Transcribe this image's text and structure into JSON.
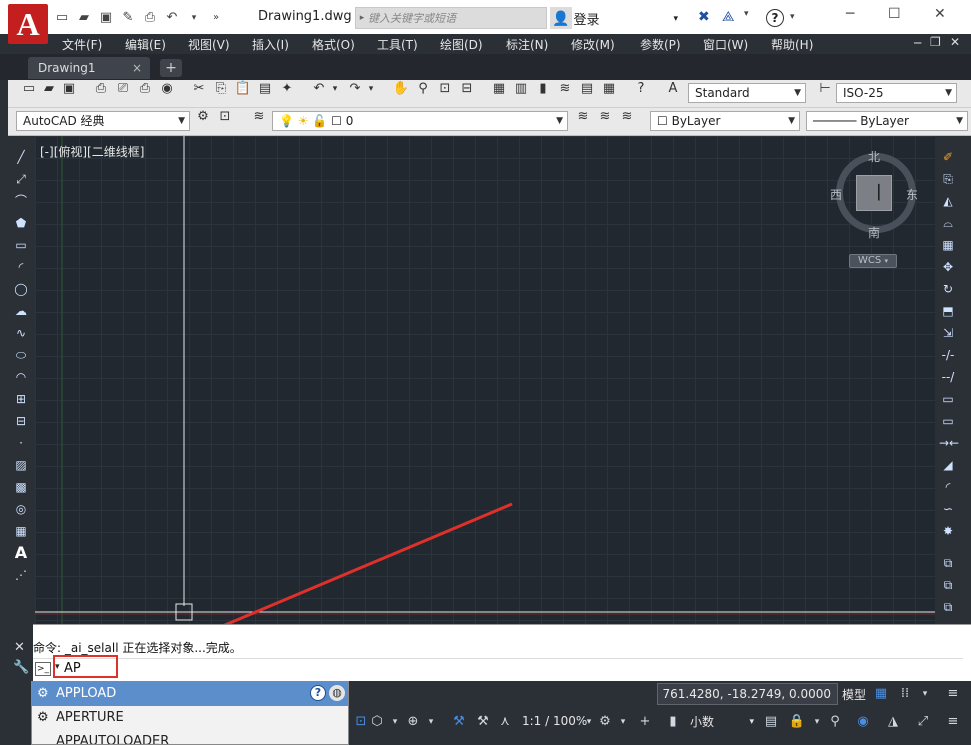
{
  "app": {
    "logo_letter": "A",
    "document_title": "Drawing1.dwg",
    "accent_color": "#c41f1f"
  },
  "titlebar": {
    "search_placeholder": "键入关键字或短语",
    "login_label": "登录",
    "window_controls": [
      "minimize-icon",
      "maximize-icon",
      "close-icon"
    ]
  },
  "menubar": {
    "items": [
      "文件(F)",
      "编辑(E)",
      "视图(V)",
      "插入(I)",
      "格式(O)",
      "工具(T)",
      "绘图(D)",
      "标注(N)",
      "修改(M)",
      "参数(P)",
      "窗口(W)",
      "帮助(H)"
    ]
  },
  "tabs": {
    "active": "Drawing1",
    "close_glyph": "×",
    "new_tab_glyph": "+"
  },
  "toolbar1": {
    "text_style": "Standard",
    "dim_style": "ISO-25"
  },
  "toolbar2": {
    "workspace": "AutoCAD 经典",
    "layer_value": "0",
    "color_value": "ByLayer",
    "linetype_value": "ByLayer"
  },
  "viewport": {
    "view_label": "[-][俯视][二维线框]",
    "compass": {
      "north": "北",
      "south": "南",
      "east": "东",
      "west": "西"
    },
    "wcs_label": "WCS",
    "grid_color": "#2b333d",
    "background_color": "#212830"
  },
  "command": {
    "history_line": "命令: _ai_selall 正在选择对象...完成。",
    "input_value": "AP"
  },
  "autocomplete": {
    "items": [
      {
        "label": "APPLOAD",
        "selected": true
      },
      {
        "label": "APERTURE",
        "selected": false
      },
      {
        "label": "APPAUTOLOADER",
        "selected": false
      }
    ],
    "help_glyph": "?"
  },
  "statusbar": {
    "coordinates": "761.4280, -18.2749, 0.0000",
    "model_label": "模型",
    "scale_label": "1:1 / 100%",
    "units_label": "小数"
  }
}
